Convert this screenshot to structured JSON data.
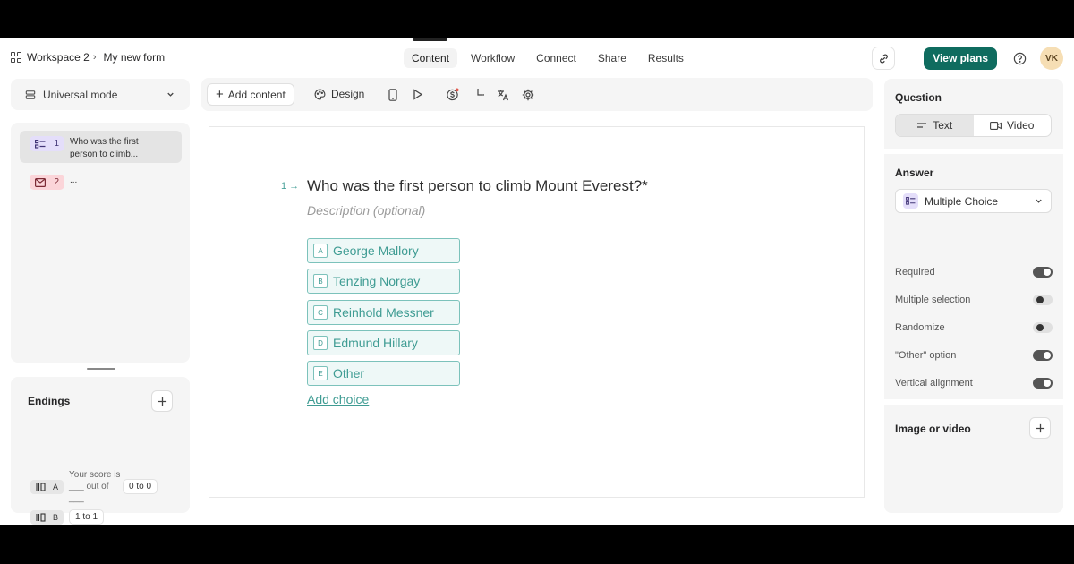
{
  "breadcrumb": {
    "workspace": "Workspace 2",
    "form": "My new form"
  },
  "nav_tabs": [
    "Content",
    "Workflow",
    "Connect",
    "Share",
    "Results"
  ],
  "header": {
    "view_plans": "View plans",
    "avatar_initials": "VK"
  },
  "mode": {
    "label": "Universal mode"
  },
  "questions": [
    {
      "num": "1",
      "text": "Who was the first person to climb...",
      "type": "multiple-choice"
    },
    {
      "num": "2",
      "text": "...",
      "type": "email"
    }
  ],
  "endings": {
    "title": "Endings",
    "items": [
      {
        "letter": "A",
        "text": "Your score is ___ out of ___",
        "chip": "0 to 0"
      },
      {
        "letter": "B",
        "text": "",
        "chip": "1 to 1"
      }
    ]
  },
  "toolbar": {
    "add_content": "Add content",
    "design": "Design"
  },
  "question": {
    "number": "1",
    "title": "Who was the first person to climb Mount Everest?*",
    "description_placeholder": "Description (optional)",
    "choices": [
      {
        "key": "A",
        "label": "George Mallory"
      },
      {
        "key": "B",
        "label": "Tenzing Norgay"
      },
      {
        "key": "C",
        "label": "Reinhold Messner"
      },
      {
        "key": "D",
        "label": "Edmund Hillary"
      },
      {
        "key": "E",
        "label": "Other"
      }
    ],
    "add_choice": "Add choice"
  },
  "panel": {
    "question_heading": "Question",
    "seg_text": "Text",
    "seg_video": "Video",
    "answer_heading": "Answer",
    "answer_type": "Multiple Choice",
    "options": [
      {
        "label": "Required",
        "on": true
      },
      {
        "label": "Multiple selection",
        "on": false
      },
      {
        "label": "Randomize",
        "on": false
      },
      {
        "label": "\"Other\" option",
        "on": true
      },
      {
        "label": "Vertical alignment",
        "on": true
      }
    ],
    "media_heading": "Image or video"
  },
  "colors": {
    "accent": "#0f6c5f",
    "choice_border": "#7cc2bb",
    "choice_text": "#3f9c93"
  }
}
